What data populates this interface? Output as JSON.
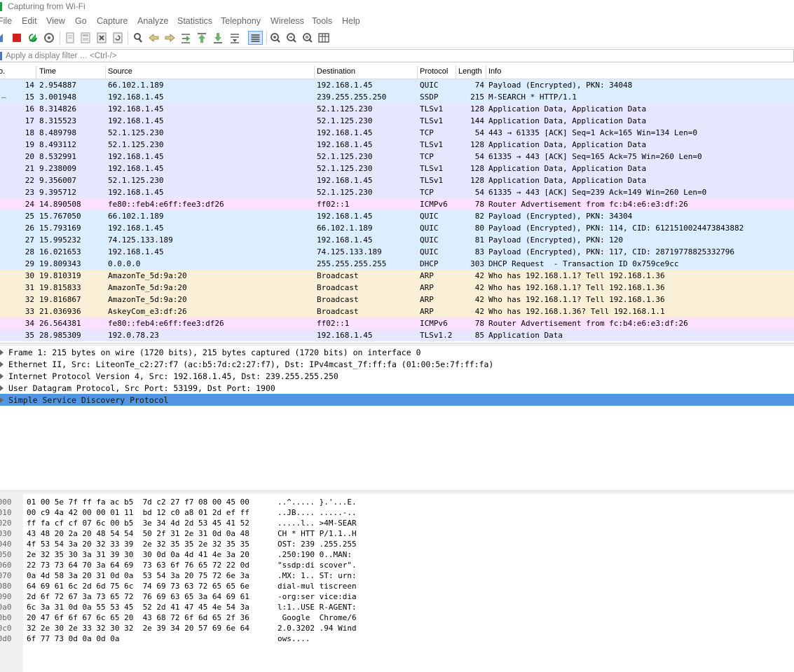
{
  "window": {
    "title": "Capturing from Wi-Fi"
  },
  "menu": [
    "File",
    "Edit",
    "View",
    "Go",
    "Capture",
    "Analyze",
    "Statistics",
    "Telephony",
    "Wireless",
    "Tools",
    "Help"
  ],
  "toolbar": {
    "icons": [
      "shark-fin-start-icon",
      "stop-capture-icon",
      "restart-capture-icon",
      "capture-options-gear-icon",
      "open-file-icon",
      "save-file-icon",
      "close-file-icon",
      "reload-file-icon",
      "find-packet-icon",
      "go-back-icon",
      "go-forward-icon",
      "go-to-packet-icon",
      "first-packet-icon",
      "last-packet-icon",
      "auto-scroll-icon",
      "colorize-icon",
      "zoom-in-icon",
      "zoom-out-icon",
      "normal-size-icon",
      "resize-columns-icon"
    ]
  },
  "filter": {
    "placeholder": "Apply a display filter … <Ctrl-/>",
    "value": ""
  },
  "columns": {
    "no": "o.",
    "time": "Time",
    "source": "Source",
    "destination": "Destination",
    "protocol": "Protocol",
    "length": "Length",
    "info": "Info"
  },
  "colors": {
    "quic": "#daeeff",
    "tcp": "#e7e6ff",
    "icmp": "#fce0ff",
    "arp": "#faf0d7",
    "selected": "#5295e0"
  },
  "packets": [
    {
      "no": "14",
      "time": "2.954887",
      "source": "66.102.1.189",
      "destination": "192.168.1.45",
      "protocol": "QUIC",
      "length": "74",
      "info": "Payload (Encrypted), PKN: 34048",
      "color": "#daeeff",
      "mark": ""
    },
    {
      "no": "15",
      "time": "3.001948",
      "source": "192.168.1.45",
      "destination": "239.255.255.250",
      "protocol": "SSDP",
      "length": "215",
      "info": "M-SEARCH * HTTP/1.1",
      "color": "#daeeff",
      "mark": "—"
    },
    {
      "no": "16",
      "time": "8.314826",
      "source": "192.168.1.45",
      "destination": "52.1.125.230",
      "protocol": "TLSv1",
      "length": "128",
      "info": "Application Data, Application Data",
      "color": "#e7e6ff",
      "mark": ""
    },
    {
      "no": "17",
      "time": "8.315523",
      "source": "192.168.1.45",
      "destination": "52.1.125.230",
      "protocol": "TLSv1",
      "length": "144",
      "info": "Application Data, Application Data",
      "color": "#e7e6ff",
      "mark": ""
    },
    {
      "no": "18",
      "time": "8.489798",
      "source": "52.1.125.230",
      "destination": "192.168.1.45",
      "protocol": "TCP",
      "length": "54",
      "info": "443 → 61335 [ACK] Seq=1 Ack=165 Win=134 Len=0",
      "color": "#e7e6ff",
      "mark": ""
    },
    {
      "no": "19",
      "time": "8.493112",
      "source": "52.1.125.230",
      "destination": "192.168.1.45",
      "protocol": "TLSv1",
      "length": "128",
      "info": "Application Data, Application Data",
      "color": "#e7e6ff",
      "mark": ""
    },
    {
      "no": "20",
      "time": "8.532991",
      "source": "192.168.1.45",
      "destination": "52.1.125.230",
      "protocol": "TCP",
      "length": "54",
      "info": "61335 → 443 [ACK] Seq=165 Ack=75 Win=260 Len=0",
      "color": "#e7e6ff",
      "mark": ""
    },
    {
      "no": "21",
      "time": "9.238009",
      "source": "192.168.1.45",
      "destination": "52.1.125.230",
      "protocol": "TLSv1",
      "length": "128",
      "info": "Application Data, Application Data",
      "color": "#e7e6ff",
      "mark": ""
    },
    {
      "no": "22",
      "time": "9.356007",
      "source": "52.1.125.230",
      "destination": "192.168.1.45",
      "protocol": "TLSv1",
      "length": "128",
      "info": "Application Data, Application Data",
      "color": "#e7e6ff",
      "mark": ""
    },
    {
      "no": "23",
      "time": "9.395712",
      "source": "192.168.1.45",
      "destination": "52.1.125.230",
      "protocol": "TCP",
      "length": "54",
      "info": "61335 → 443 [ACK] Seq=239 Ack=149 Win=260 Len=0",
      "color": "#e7e6ff",
      "mark": ""
    },
    {
      "no": "24",
      "time": "14.890508",
      "source": "fe80::feb4:e6ff:fee3:df26",
      "destination": "ff02::1",
      "protocol": "ICMPv6",
      "length": "78",
      "info": "Router Advertisement from fc:b4:e6:e3:df:26",
      "color": "#fce0ff",
      "mark": ""
    },
    {
      "no": "25",
      "time": "15.767050",
      "source": "66.102.1.189",
      "destination": "192.168.1.45",
      "protocol": "QUIC",
      "length": "82",
      "info": "Payload (Encrypted), PKN: 34304",
      "color": "#daeeff",
      "mark": ""
    },
    {
      "no": "26",
      "time": "15.793169",
      "source": "192.168.1.45",
      "destination": "66.102.1.189",
      "protocol": "QUIC",
      "length": "80",
      "info": "Payload (Encrypted), PKN: 114, CID: 6121510024473843882",
      "color": "#daeeff",
      "mark": ""
    },
    {
      "no": "27",
      "time": "15.995232",
      "source": "74.125.133.189",
      "destination": "192.168.1.45",
      "protocol": "QUIC",
      "length": "81",
      "info": "Payload (Encrypted), PKN: 120",
      "color": "#daeeff",
      "mark": ""
    },
    {
      "no": "28",
      "time": "16.021653",
      "source": "192.168.1.45",
      "destination": "74.125.133.189",
      "protocol": "QUIC",
      "length": "83",
      "info": "Payload (Encrypted), PKN: 117, CID: 2871977882533279​6",
      "color": "#daeeff",
      "mark": ""
    },
    {
      "no": "29",
      "time": "19.809343",
      "source": "0.0.0.0",
      "destination": "255.255.255.255",
      "protocol": "DHCP",
      "length": "303",
      "info": "DHCP Request  - Transaction ID 0x759ce9cc",
      "color": "#daeeff",
      "mark": ""
    },
    {
      "no": "30",
      "time": "19.810319",
      "source": "AmazonTe_5d:9a:20",
      "destination": "Broadcast",
      "protocol": "ARP",
      "length": "42",
      "info": "Who has 192.168.1.1? Tell 192.168.1.36",
      "color": "#faf0d7",
      "mark": ""
    },
    {
      "no": "31",
      "time": "19.815833",
      "source": "AmazonTe_5d:9a:20",
      "destination": "Broadcast",
      "protocol": "ARP",
      "length": "42",
      "info": "Who has 192.168.1.1? Tell 192.168.1.36",
      "color": "#faf0d7",
      "mark": ""
    },
    {
      "no": "32",
      "time": "19.816867",
      "source": "AmazonTe_5d:9a:20",
      "destination": "Broadcast",
      "protocol": "ARP",
      "length": "42",
      "info": "Who has 192.168.1.1? Tell 192.168.1.36",
      "color": "#faf0d7",
      "mark": ""
    },
    {
      "no": "33",
      "time": "21.036936",
      "source": "AskeyCom_e3:df:26",
      "destination": "Broadcast",
      "protocol": "ARP",
      "length": "42",
      "info": "Who has 192.168.1.36? Tell 192.168.1.1",
      "color": "#faf0d7",
      "mark": ""
    },
    {
      "no": "34",
      "time": "26.564381",
      "source": "fe80::feb4:e6ff:fee3:df26",
      "destination": "ff02::1",
      "protocol": "ICMPv6",
      "length": "78",
      "info": "Router Advertisement from fc:b4:e6:e3:df:26",
      "color": "#fce0ff",
      "mark": ""
    },
    {
      "no": "35",
      "time": "28.985309",
      "source": "192.0.78.23",
      "destination": "192.168.1.45",
      "protocol": "TLSv1.2",
      "length": "85",
      "info": "Application Data",
      "color": "#e7e6ff",
      "mark": ""
    }
  ],
  "details": [
    {
      "text": "Frame 1: 215 bytes on wire (1720 bits), 215 bytes captured (1720 bits) on interface 0",
      "selected": false
    },
    {
      "text": "Ethernet II, Src: LiteonTe_c2:27:f7 (ac:b5:7d:c2:27:f7), Dst: IPv4mcast_7f:ff:fa (01:00:5e:7f:ff:fa)",
      "selected": false
    },
    {
      "text": "Internet Protocol Version 4, Src: 192.168.1.45, Dst: 239.255.255.250",
      "selected": false
    },
    {
      "text": "User Datagram Protocol, Src Port: 53199, Dst Port: 1900",
      "selected": false
    },
    {
      "text": "Simple Service Discovery Protocol",
      "selected": true
    }
  ],
  "bytes": [
    {
      "offset": "0000",
      "hex": "01 00 5e 7f ff fa ac b5  7d c2 27 f7 08 00 45 00",
      "ascii": "..^..... }.'...E."
    },
    {
      "offset": "0010",
      "hex": "00 c9 4a 42 00 00 01 11  bd 12 c0 a8 01 2d ef ff",
      "ascii": "..JB.... .....-.."
    },
    {
      "offset": "0020",
      "hex": "ff fa cf cf 07 6c 00 b5  3e 34 4d 2d 53 45 41 52",
      "ascii": ".....l.. >4M-SEAR"
    },
    {
      "offset": "0030",
      "hex": "43 48 20 2a 20 48 54 54  50 2f 31 2e 31 0d 0a 48",
      "ascii": "CH * HTT P/1.1..H"
    },
    {
      "offset": "0040",
      "hex": "4f 53 54 3a 20 32 33 39  2e 32 35 35 2e 32 35 35",
      "ascii": "OST: 239 .255.255"
    },
    {
      "offset": "0050",
      "hex": "2e 32 35 30 3a 31 39 30  30 0d 0a 4d 41 4e 3a 20",
      "ascii": ".250:190 0..MAN:"
    },
    {
      "offset": "0060",
      "hex": "22 73 73 64 70 3a 64 69  73 63 6f 76 65 72 22 0d",
      "ascii": "\"ssdp:di scover\"."
    },
    {
      "offset": "0070",
      "hex": "0a 4d 58 3a 20 31 0d 0a  53 54 3a 20 75 72 6e 3a",
      "ascii": ".MX: 1.. ST: urn:"
    },
    {
      "offset": "0080",
      "hex": "64 69 61 6c 2d 6d 75 6c  74 69 73 63 72 65 65 6e",
      "ascii": "dial-mul tiscreen"
    },
    {
      "offset": "0090",
      "hex": "2d 6f 72 67 3a 73 65 72  76 69 63 65 3a 64 69 61",
      "ascii": "-org:ser vice:dia"
    },
    {
      "offset": "00a0",
      "hex": "6c 3a 31 0d 0a 55 53 45  52 2d 41 47 45 4e 54 3a",
      "ascii": "l:1..USE R-AGENT:"
    },
    {
      "offset": "00b0",
      "hex": "20 47 6f 6f 67 6c 65 20  43 68 72 6f 6d 65 2f 36",
      "ascii": " Google  Chrome/6"
    },
    {
      "offset": "00c0",
      "hex": "32 2e 30 2e 33 32 30 32  2e 39 34 20 57 69 6e 64",
      "ascii": "2.0.3202 .94 Wind"
    },
    {
      "offset": "00d0",
      "hex": "6f 77 73 0d 0a 0d 0a",
      "ascii": "ows...."
    }
  ]
}
